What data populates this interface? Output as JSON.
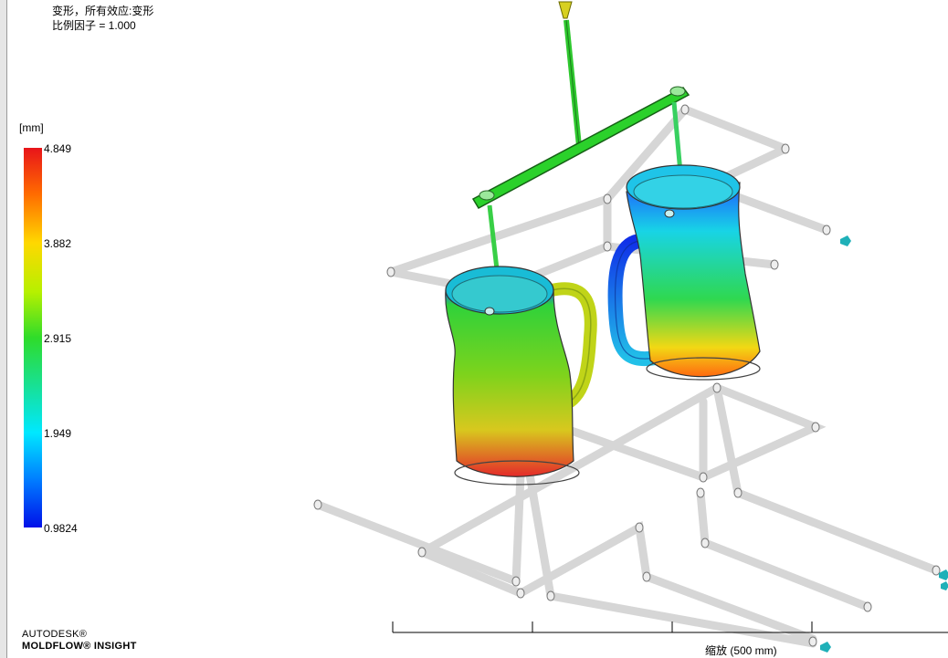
{
  "result": {
    "title": "变形，所有效应:变形",
    "scale_factor": "比例因子 = 1.000"
  },
  "legend": {
    "unit": "[mm]",
    "ticks": [
      "4.849",
      "3.882",
      "2.915",
      "1.949",
      "0.9824"
    ],
    "colors": {
      "max": "#e8141a",
      "mid": "#2fdc2a",
      "min": "#0010e8"
    }
  },
  "branding": {
    "line1": "AUTODESK®",
    "line2": "MOLDFLOW® INSIGHT"
  },
  "scale_bar": {
    "label": "缩放 (500 mm)"
  }
}
